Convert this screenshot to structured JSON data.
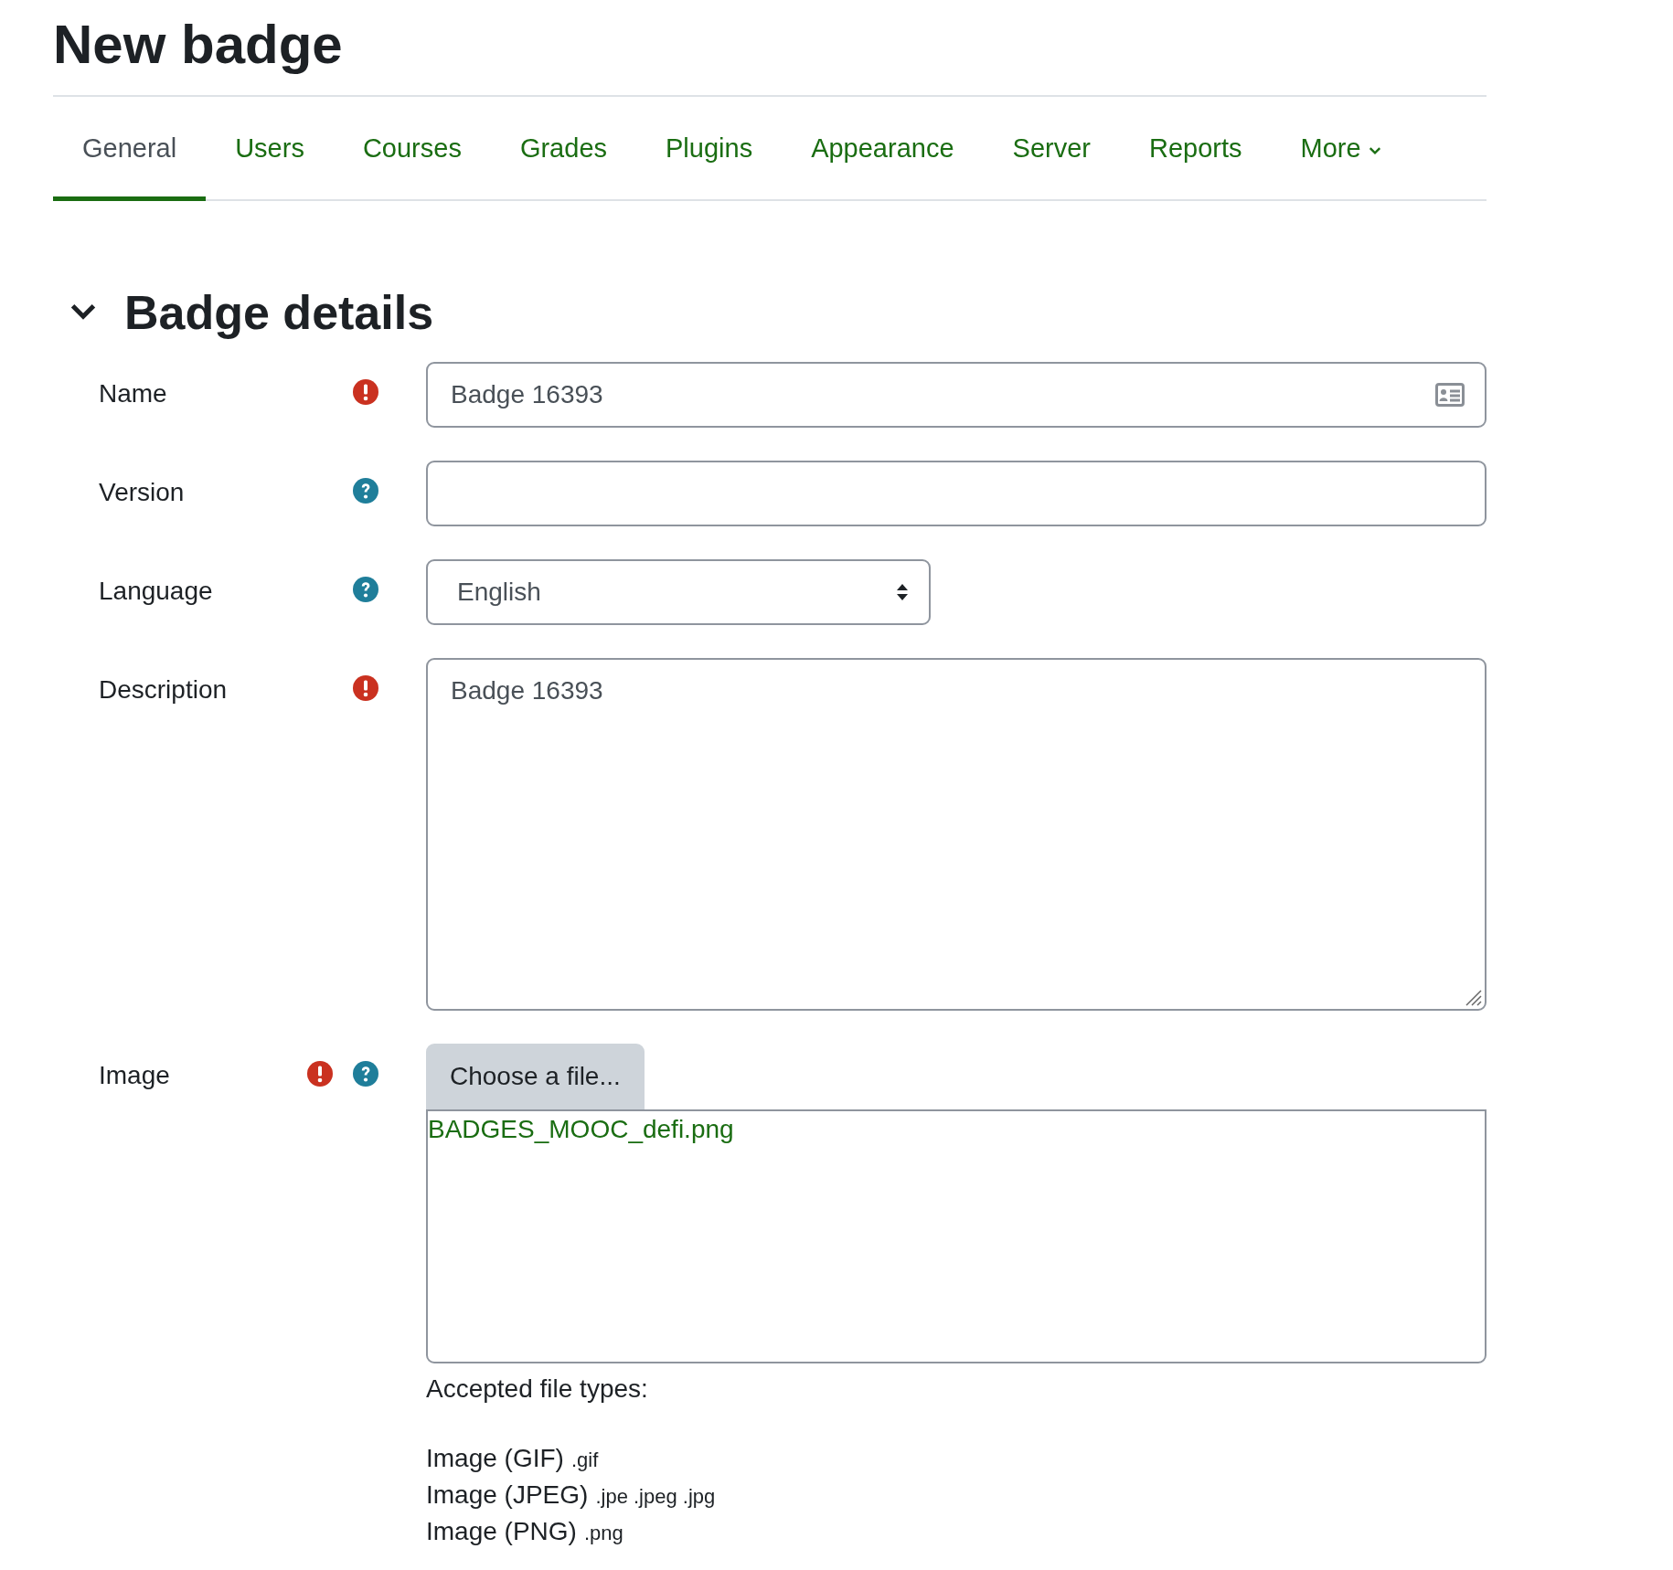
{
  "page_title": "New badge",
  "tabs": [
    {
      "label": "General",
      "selected": true,
      "dropdown": false
    },
    {
      "label": "Users",
      "selected": false,
      "dropdown": false
    },
    {
      "label": "Courses",
      "selected": false,
      "dropdown": false
    },
    {
      "label": "Grades",
      "selected": false,
      "dropdown": false
    },
    {
      "label": "Plugins",
      "selected": false,
      "dropdown": false
    },
    {
      "label": "Appearance",
      "selected": false,
      "dropdown": false
    },
    {
      "label": "Server",
      "selected": false,
      "dropdown": false
    },
    {
      "label": "Reports",
      "selected": false,
      "dropdown": false
    },
    {
      "label": "More",
      "selected": false,
      "dropdown": true
    }
  ],
  "section": {
    "title": "Badge details",
    "expanded": true
  },
  "fields": [
    {
      "kind": "text-with-icon",
      "label": "Name",
      "required": true,
      "help": false,
      "value": "Badge 16393"
    },
    {
      "kind": "text",
      "label": "Version",
      "required": false,
      "help": true
    },
    {
      "kind": "select",
      "label": "Language",
      "required": false,
      "help": true,
      "value": "English"
    },
    {
      "kind": "textarea",
      "label": "Description",
      "required": true,
      "help": false,
      "value": "Badge 16393"
    },
    {
      "kind": "filepicker",
      "label": "Image",
      "required": true,
      "help": true,
      "button": "Choose a file...",
      "file": "BADGES_MOOC_defi.png",
      "accepted_label": "Accepted file types:",
      "types": [
        {
          "name": "Image (GIF)",
          "extensions": ".gif"
        },
        {
          "name": "Image (JPEG)",
          "extensions": ".jpe .jpeg .jpg"
        },
        {
          "name": "Image (PNG)",
          "extensions": ".png"
        }
      ]
    }
  ]
}
